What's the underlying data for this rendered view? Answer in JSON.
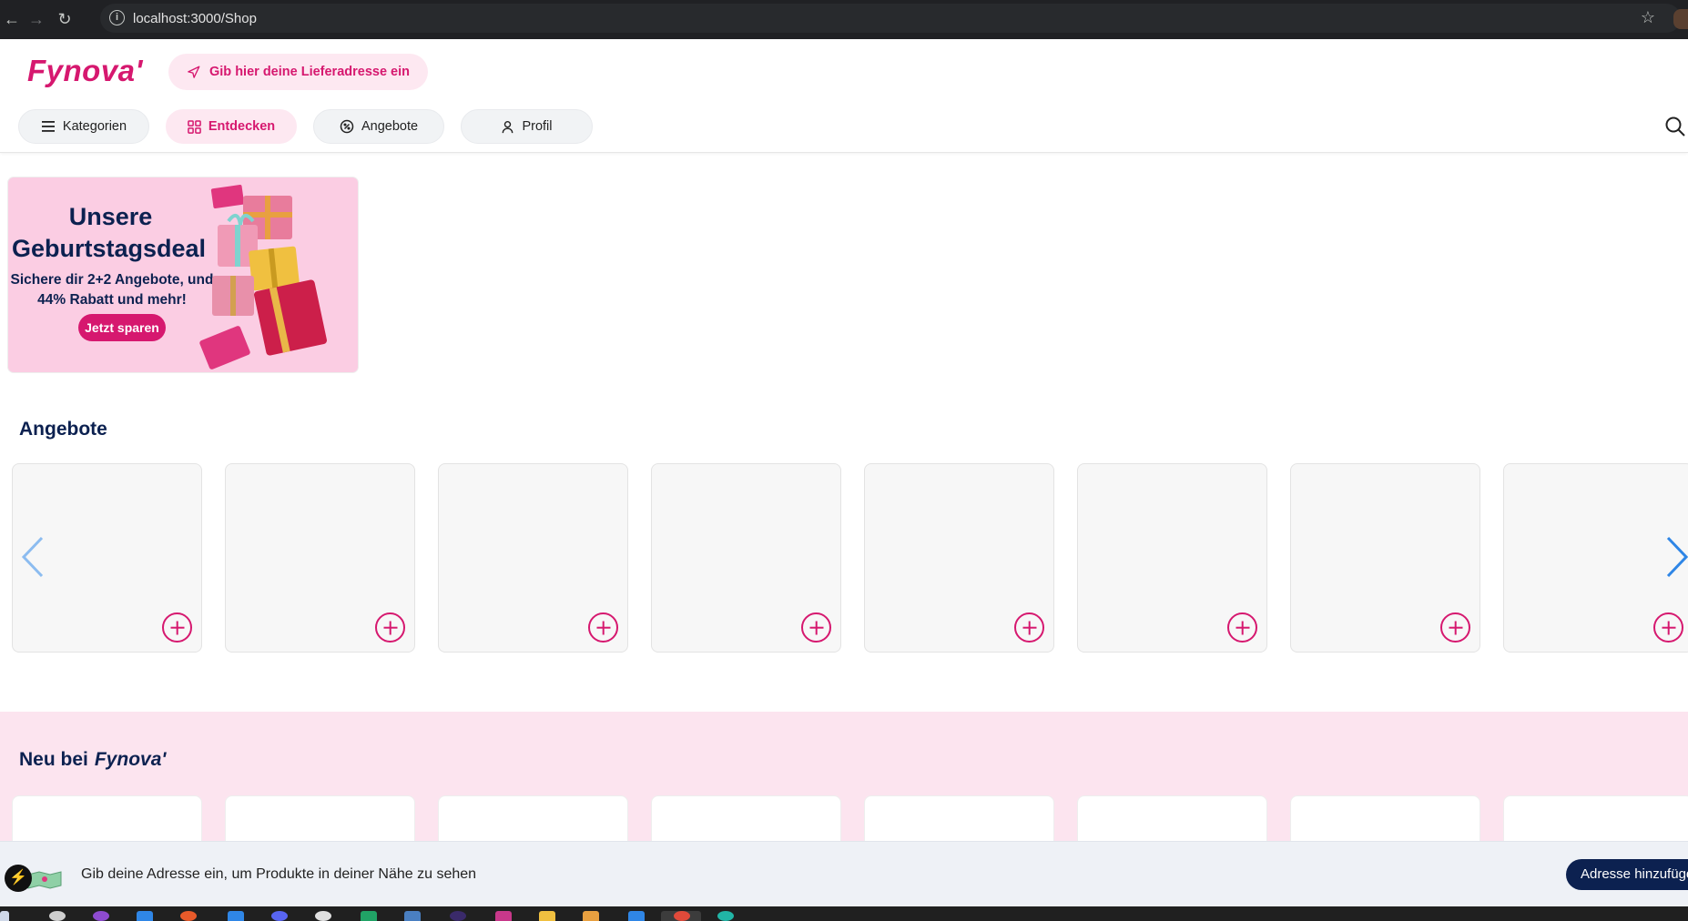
{
  "browser": {
    "url": "localhost:3000/Shop"
  },
  "header": {
    "logo": "Fynova'",
    "address_prompt": "Gib hier deine Lieferadresse ein",
    "nav": [
      {
        "label": "Kategorien",
        "icon": "menu-icon",
        "active": false
      },
      {
        "label": "Entdecken",
        "icon": "grid-icon",
        "active": true
      },
      {
        "label": "Angebote",
        "icon": "discount-icon",
        "active": false
      },
      {
        "label": "Profil",
        "icon": "user-icon",
        "active": false
      }
    ]
  },
  "banner": {
    "line1": "Unsere",
    "line2": "Geburtstagsdeal",
    "line3": "Sichere dir 2+2 Angebote, und",
    "line4": "44% Rabatt und mehr!",
    "cta": "Jetzt sparen"
  },
  "sections": {
    "offers_title": "Angebote",
    "new_title_prefix": "Neu bei",
    "new_title_brand": "Fynova'"
  },
  "address_bar": {
    "text": "Gib deine Adresse ein, um Produkte in deiner Nähe zu sehen",
    "button": "Adresse hinzufügen"
  },
  "colors": {
    "brand": "#d6186f",
    "navy": "#0c2150",
    "pink_light": "#fde8f1",
    "section_band": "#fce4ef"
  }
}
